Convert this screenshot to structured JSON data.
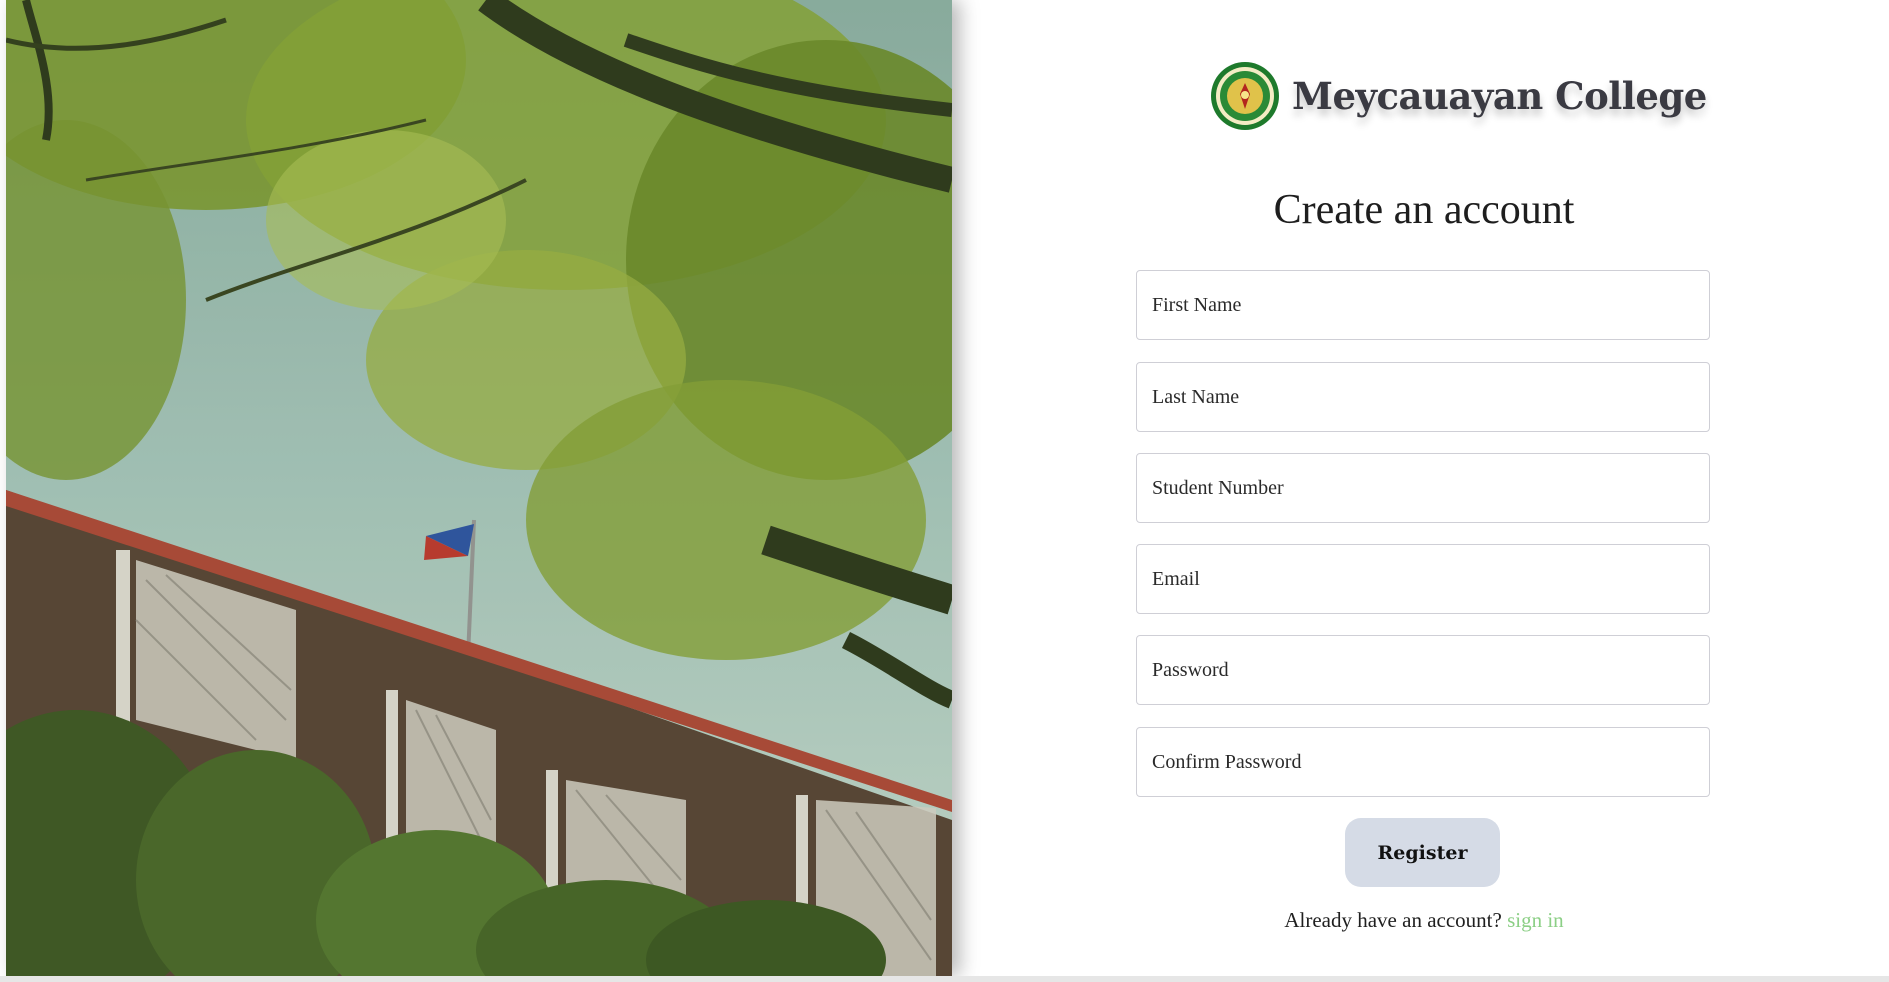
{
  "brand": {
    "name": "Meycauayan College",
    "seal_icon": "college-seal-icon",
    "seal_colors": {
      "ring": "#1e7a2c",
      "inner": "#e0c24a"
    }
  },
  "form": {
    "title": "Create an account",
    "fields": {
      "first_name": {
        "placeholder": "First Name",
        "value": ""
      },
      "last_name": {
        "placeholder": "Last Name",
        "value": ""
      },
      "student_number": {
        "placeholder": "Student Number",
        "value": ""
      },
      "email": {
        "placeholder": "Email",
        "value": ""
      },
      "password": {
        "placeholder": "Password",
        "value": ""
      },
      "confirm_password": {
        "placeholder": "Confirm Password",
        "value": ""
      }
    },
    "register_label": "Register",
    "signin_prompt": "Already have an account?",
    "signin_link": "sign in"
  },
  "colors": {
    "accent_link": "#8ccf86",
    "button_bg": "#d5dbe6",
    "brand_text": "#3a3a42"
  }
}
